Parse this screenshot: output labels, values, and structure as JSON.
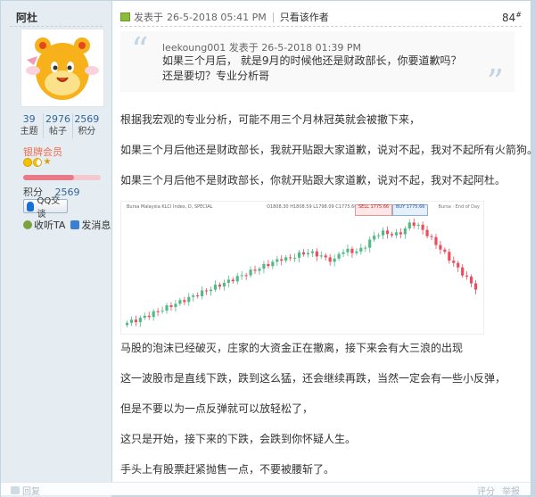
{
  "user": {
    "name": "阿杜",
    "stats": [
      {
        "value": "39",
        "label": "主题"
      },
      {
        "value": "2976",
        "label": "帖子"
      },
      {
        "value": "2569",
        "label": "积分"
      }
    ],
    "group": "银牌会员",
    "level_progress": 0.65,
    "credits_label": "积分",
    "credits_value": "2569",
    "qq_button": "QQ交谈",
    "follow_label": "收听TA",
    "message_label": "发消息",
    "colors": {
      "group": "#f26c4f",
      "link": "#336699"
    }
  },
  "post": {
    "posted_prefix": "发表于",
    "posted_time": "26-5-2018 05:41 PM",
    "author_only": "只看该作者",
    "floor": "84",
    "floor_suffix": "#"
  },
  "quote": {
    "author": "leekoung001",
    "posted_prefix": "发表于",
    "posted_time": "26-5-2018 01:39 PM",
    "text": "如果三个月后， 就是9月的时候他还是财政部长，你要道歉吗？ 还是要切？专业分析哥"
  },
  "body": {
    "p1": "根据我宏观的专业分析，可能不用三个月林冠英就会被撤下来，",
    "p2": "如果三个月后他还是财政部长，我就开贴跟大家道歉，说对不起，我对不起所有火箭狗。",
    "p3": "如果三个月后他不是财政部长，你就开贴跟大家道歉，说对不起，我对不起阿杜。",
    "p4": "马股的泡沫已经破灭，庄家的大资金正在撤离，接下来会有大三浪的出现",
    "p5": "这一波股市是直线下跌，跌到这么猛，还会继续再跌，当然一定会有一些小反弹，",
    "p6": "但是不要以为一点反弹就可以放轻松了，",
    "p7": "这只是开始，接下来的下跌，会跌到你怀疑人生。",
    "p8": "手头上有股票赶紧抛售一点，不要被腰斩了。"
  },
  "chart": {
    "title": "Bursa Malaysia KLCI Index, D, SPECIAL",
    "values_text": "O1808.30 H1808.59 L1798.09 C1775.66",
    "sell_label": "SELL",
    "sell_price": "1775.66",
    "buy_label": "BUY",
    "buy_price": "1775.66",
    "note": "Bursa · End of Day",
    "colors": {
      "up": "#53b987",
      "down": "#eb4d5c"
    }
  },
  "footer": {
    "reply": "回复",
    "rate": "评分",
    "report": "举报"
  }
}
